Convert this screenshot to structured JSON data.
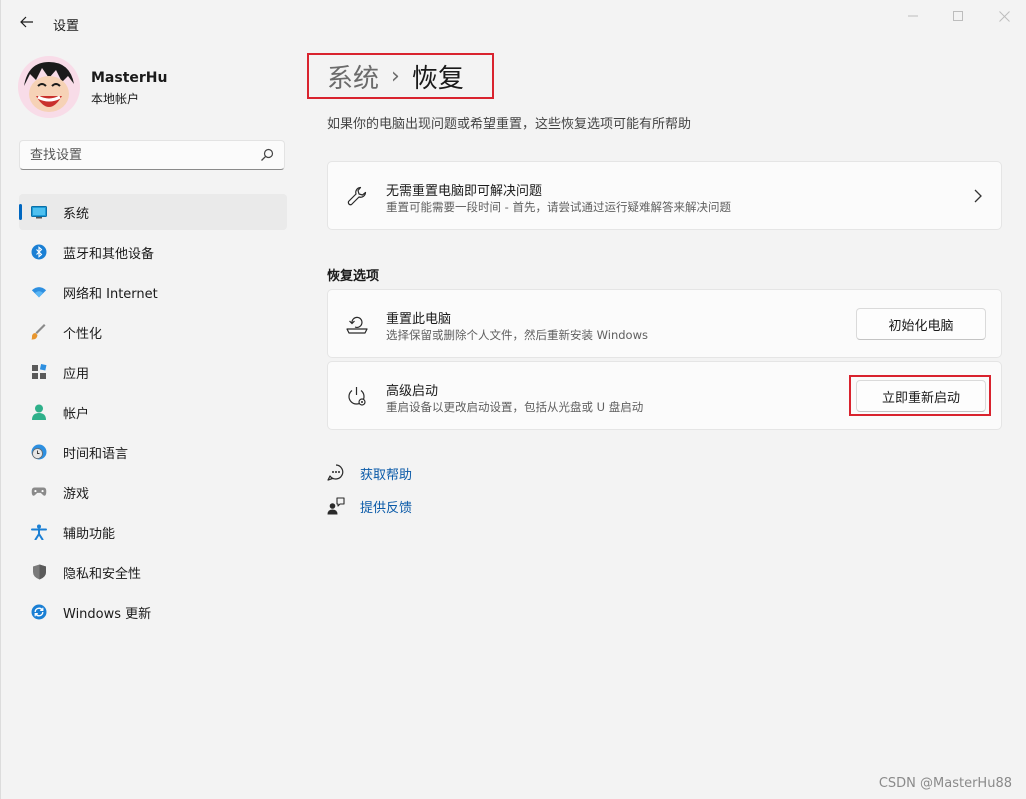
{
  "window": {
    "title": "设置"
  },
  "profile": {
    "name": "MasterHu",
    "account_type": "本地帐户"
  },
  "search": {
    "placeholder": "查找设置"
  },
  "sidebar": {
    "items": [
      {
        "label": "系统",
        "icon": "display-icon",
        "active": true
      },
      {
        "label": "蓝牙和其他设备",
        "icon": "bluetooth-icon"
      },
      {
        "label": "网络和 Internet",
        "icon": "wifi-icon"
      },
      {
        "label": "个性化",
        "icon": "brush-icon"
      },
      {
        "label": "应用",
        "icon": "apps-icon"
      },
      {
        "label": "帐户",
        "icon": "person-icon"
      },
      {
        "label": "时间和语言",
        "icon": "clock-globe-icon"
      },
      {
        "label": "游戏",
        "icon": "gamepad-icon"
      },
      {
        "label": "辅助功能",
        "icon": "accessibility-icon"
      },
      {
        "label": "隐私和安全性",
        "icon": "shield-icon"
      },
      {
        "label": "Windows 更新",
        "icon": "update-icon"
      }
    ]
  },
  "main": {
    "breadcrumb": {
      "parent": "系统",
      "separator": "›",
      "current": "恢复"
    },
    "description": "如果你的电脑出现问题或希望重置，这些恢复选项可能有所帮助",
    "troubleshoot_card": {
      "title": "无需重置电脑即可解决问题",
      "subtitle": "重置可能需要一段时间 - 首先，请尝试通过运行疑难解答来解决问题"
    },
    "section_title": "恢复选项",
    "reset_card": {
      "title": "重置此电脑",
      "subtitle": "选择保留或删除个人文件，然后重新安装 Windows",
      "button": "初始化电脑"
    },
    "advanced_card": {
      "title": "高级启动",
      "subtitle": "重启设备以更改启动设置，包括从光盘或 U 盘启动",
      "button": "立即重新启动"
    },
    "links": [
      {
        "label": "获取帮助",
        "icon": "help-icon"
      },
      {
        "label": "提供反馈",
        "icon": "feedback-icon"
      }
    ]
  },
  "watermark": "CSDN @MasterHu88",
  "colors": {
    "accent": "#0067c0",
    "highlight": "#d9232e",
    "link": "#0a5aa8"
  }
}
